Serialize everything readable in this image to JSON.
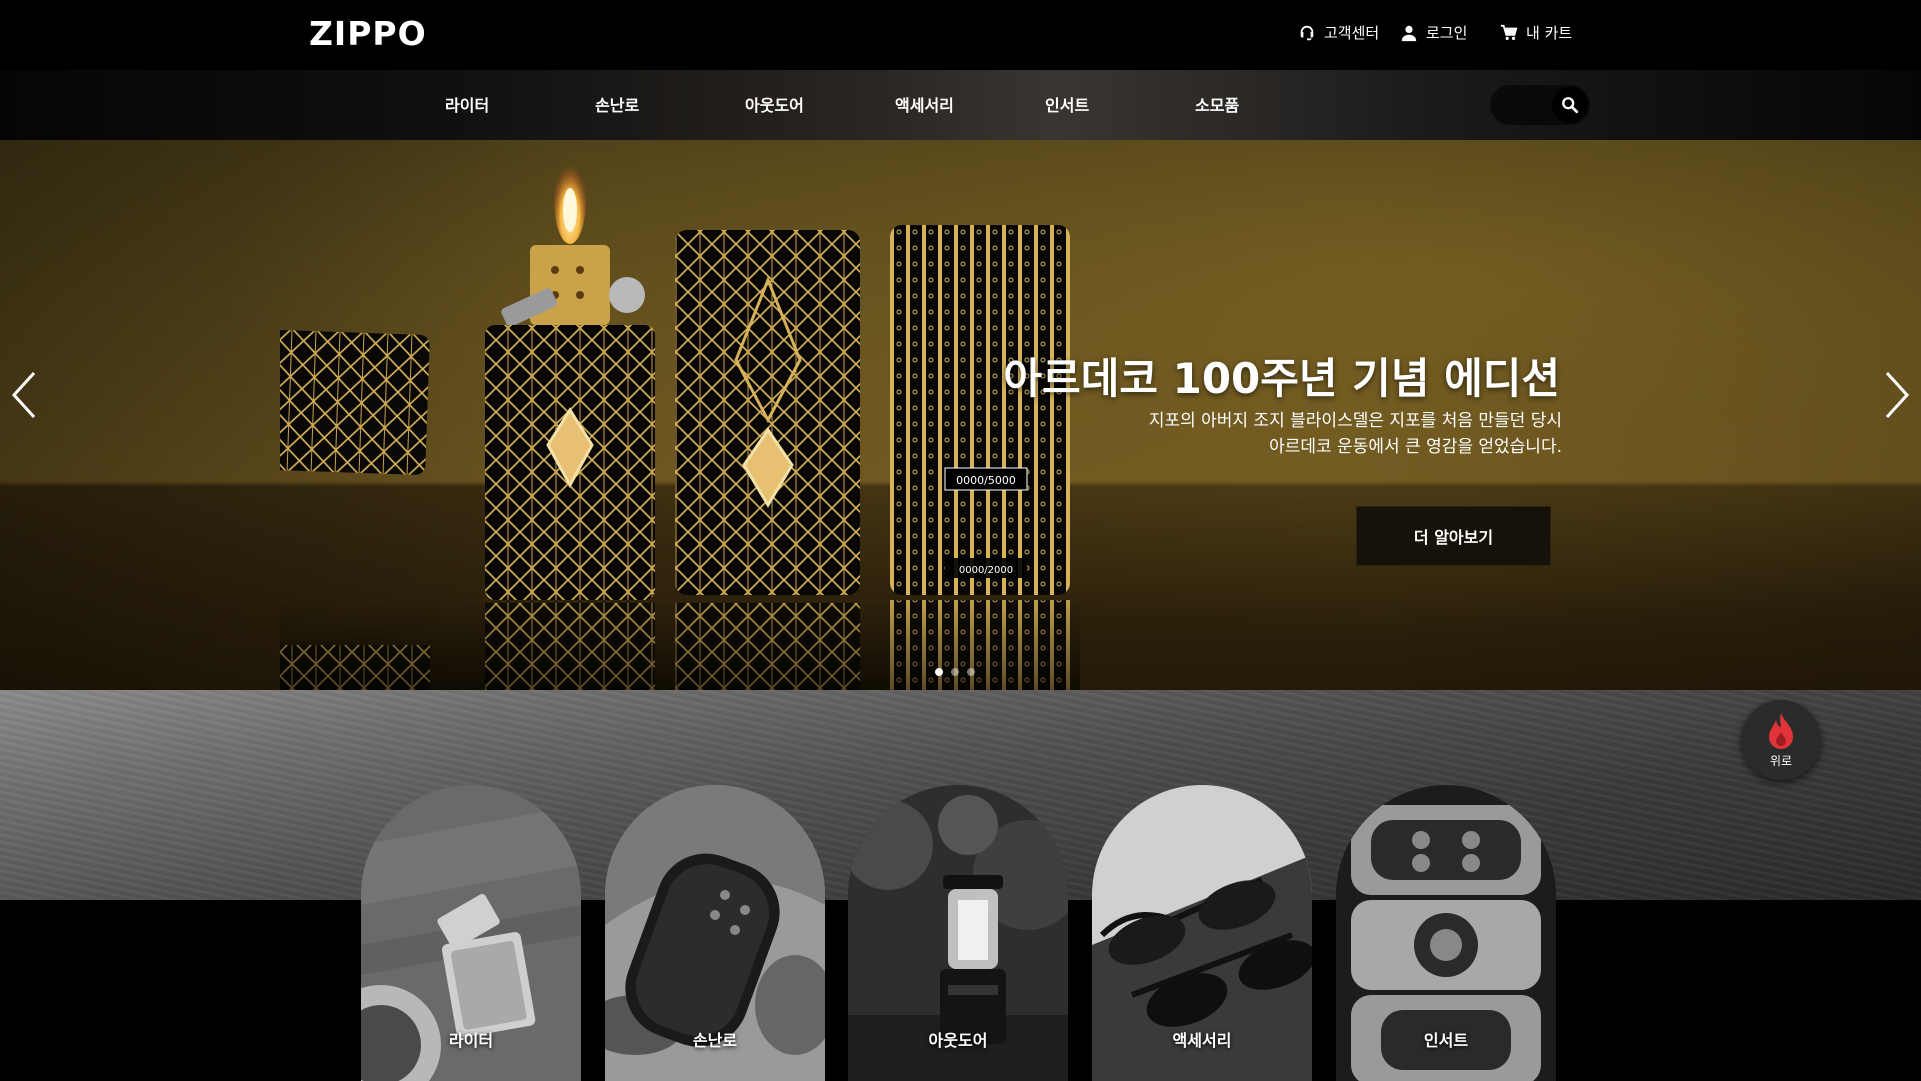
{
  "header": {
    "logo": "ZIPPO",
    "utility": {
      "customer_center": "고객센터",
      "login": "로그인",
      "cart": "내 카트"
    }
  },
  "nav": {
    "items": [
      "라이터",
      "손난로",
      "아웃도어",
      "액세서리",
      "인서트",
      "소모품"
    ],
    "search_icon": "search-icon"
  },
  "hero": {
    "title": "아르데코 100주년 기념 에디션",
    "description_line1": "지포의 아버지 조지 블라이스델은 지포를 처음 만들던 당시",
    "description_line2": "아르데코 운동에서 큰 영감을 얻었습니다.",
    "cta_label": "더 알아보기",
    "product_label_top": "0000/5000",
    "product_label_reflection": "0000/2000",
    "slide_count": 3,
    "active_slide": 1
  },
  "categories": [
    {
      "label": "라이터"
    },
    {
      "label": "손난로"
    },
    {
      "label": "아웃도어"
    },
    {
      "label": "액세서리"
    },
    {
      "label": "인서트"
    }
  ],
  "top_button": {
    "label": "위로",
    "icon": "flame-icon"
  },
  "colors": {
    "background": "#000000",
    "gold": "#d6b35a",
    "flame": "#e0343a"
  }
}
